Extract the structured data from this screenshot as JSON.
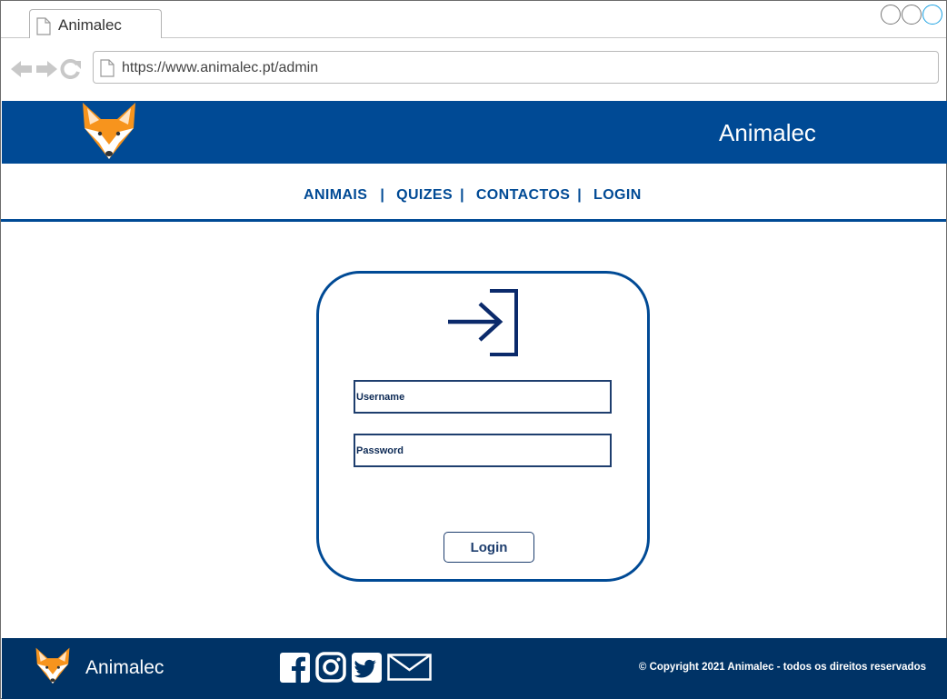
{
  "browser": {
    "tab_title": "Animalec",
    "url": "https://www.animalec.pt/admin"
  },
  "header": {
    "brand": "Animalec",
    "logo_icon": "fox-logo-icon"
  },
  "menu": {
    "items": [
      "ANIMAIS",
      "QUIZES",
      "CONTACTOS",
      "LOGIN"
    ],
    "separator": "|"
  },
  "login": {
    "icon": "login-arrow-icon",
    "username_placeholder": "Username",
    "password_placeholder": "Password",
    "button_label": "Login"
  },
  "footer": {
    "brand": "Animalec",
    "socials": [
      "facebook-icon",
      "instagram-icon",
      "twitter-icon",
      "mail-icon"
    ],
    "copyright": "© Copyright 2021 Animalec - todos os direitos reservados"
  },
  "colors": {
    "header_bg": "#004a95",
    "footer_bg": "#003366",
    "accent": "#004a95",
    "fox_orange": "#f7941d"
  }
}
